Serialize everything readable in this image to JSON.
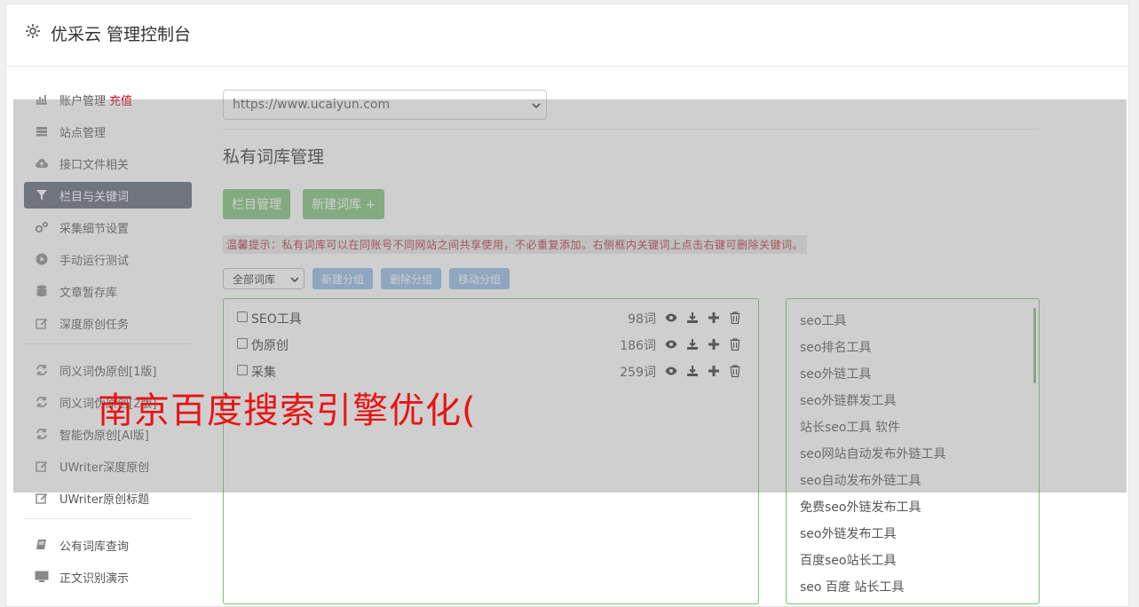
{
  "app": {
    "title": "优采云 管理控制台"
  },
  "sidebar": {
    "items": [
      {
        "label": "账户管理",
        "extra": "充值",
        "icon": "bar-chart-icon"
      },
      {
        "label": "站点管理",
        "icon": "server-icon"
      },
      {
        "label": "接口文件相关",
        "icon": "cloud-upload-icon"
      },
      {
        "label": "栏目与关键词",
        "icon": "filter-icon",
        "active": true
      },
      {
        "label": "采集细节设置",
        "icon": "gears-icon"
      },
      {
        "label": "手动运行测试",
        "icon": "play-circle-icon"
      },
      {
        "label": "文章暂存库",
        "icon": "database-icon"
      },
      {
        "label": "深度原创任务",
        "icon": "edit-icon"
      }
    ],
    "items2": [
      {
        "label": "同义词伪原创[1版]",
        "icon": "refresh-icon"
      },
      {
        "label": "同义词伪原创[2版]",
        "icon": "refresh-icon"
      },
      {
        "label": "智能伪原创[AI版]",
        "icon": "refresh-icon"
      },
      {
        "label": "UWriter深度原创",
        "icon": "edit-icon"
      },
      {
        "label": "UWriter原创标题",
        "icon": "edit-icon"
      }
    ],
    "items3": [
      {
        "label": "公有词库查询",
        "icon": "book-icon"
      },
      {
        "label": "正文识别演示",
        "icon": "monitor-icon"
      }
    ]
  },
  "main": {
    "site_select": "https://www.ucaiyun.com",
    "page_title": "私有词库管理",
    "btn_column_manage": "栏目管理",
    "btn_new_library": "新建词库 +",
    "tip": "温馨提示：私有词库可以在同账号不同网站之间共享使用，不必重复添加。右侧框内关键词上点击右键可删除关键词。",
    "filter_select": "全部词库",
    "btn_new_group": "新建分组",
    "btn_delete_group": "删除分组",
    "btn_move_group": "移动分组",
    "libraries": [
      {
        "name": "SEO工具",
        "count": "98词"
      },
      {
        "name": "伪原创",
        "count": "186词"
      },
      {
        "name": "采集",
        "count": "259词"
      }
    ],
    "keywords": [
      "seo工具",
      "seo排名工具",
      "seo外链工具",
      "seo外链群发工具",
      "站长seo工具 软件",
      "seo网站自动发布外链工具",
      "seo自动发布外链工具",
      "免费seo外链发布工具",
      "seo外链发布工具",
      "百度seo站长工具",
      "seo 百度 站长工具"
    ]
  },
  "overlay": {
    "text": "南京百度搜索引擎优化("
  }
}
